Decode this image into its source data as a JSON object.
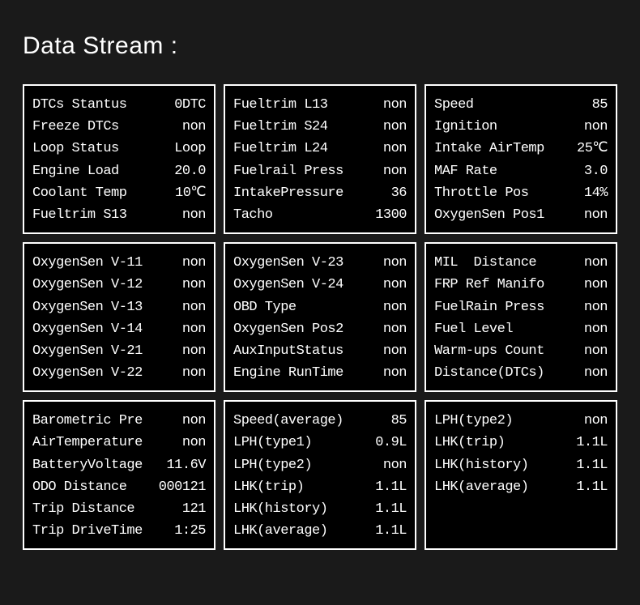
{
  "title": "Data Stream :",
  "panels": [
    {
      "rows": [
        {
          "label": "DTCs Stantus",
          "value": "0DTC"
        },
        {
          "label": "Freeze DTCs",
          "value": "non"
        },
        {
          "label": "Loop Status",
          "value": "Loop"
        },
        {
          "label": "Engine Load",
          "value": "20.0"
        },
        {
          "label": "Coolant Temp",
          "value": "10℃"
        },
        {
          "label": "Fueltrim S13",
          "value": "non"
        }
      ]
    },
    {
      "rows": [
        {
          "label": "Fueltrim L13",
          "value": "non"
        },
        {
          "label": "Fueltrim S24",
          "value": "non"
        },
        {
          "label": "Fueltrim L24",
          "value": "non"
        },
        {
          "label": "Fuelrail Press",
          "value": "non"
        },
        {
          "label": "IntakePressure",
          "value": "36"
        },
        {
          "label": "Tacho",
          "value": "1300"
        }
      ]
    },
    {
      "rows": [
        {
          "label": "Speed",
          "value": "85"
        },
        {
          "label": "Ignition",
          "value": "non"
        },
        {
          "label": "Intake AirTemp",
          "value": "25℃"
        },
        {
          "label": "MAF Rate",
          "value": "3.0"
        },
        {
          "label": "Throttle Pos",
          "value": "14%"
        },
        {
          "label": "OxygenSen Pos1",
          "value": "non"
        }
      ]
    },
    {
      "rows": [
        {
          "label": "OxygenSen V-11",
          "value": "non"
        },
        {
          "label": "OxygenSen V-12",
          "value": "non"
        },
        {
          "label": "OxygenSen V-13",
          "value": "non"
        },
        {
          "label": "OxygenSen V-14",
          "value": "non"
        },
        {
          "label": "OxygenSen V-21",
          "value": "non"
        },
        {
          "label": "OxygenSen V-22",
          "value": "non"
        }
      ]
    },
    {
      "rows": [
        {
          "label": "OxygenSen V-23",
          "value": "non"
        },
        {
          "label": "OxygenSen V-24",
          "value": "non"
        },
        {
          "label": "OBD Type",
          "value": "non"
        },
        {
          "label": "OxygenSen Pos2",
          "value": "non"
        },
        {
          "label": "AuxInputStatus",
          "value": "non"
        },
        {
          "label": "Engine RunTime",
          "value": "non"
        }
      ]
    },
    {
      "rows": [
        {
          "label": "MIL  Distance",
          "value": "non"
        },
        {
          "label": "FRP Ref Manifo",
          "value": "non"
        },
        {
          "label": "FuelRain Press",
          "value": "non"
        },
        {
          "label": "Fuel Level",
          "value": "non"
        },
        {
          "label": "Warm-ups Count",
          "value": "non"
        },
        {
          "label": "Distance(DTCs)",
          "value": "non"
        }
      ]
    },
    {
      "rows": [
        {
          "label": "Barometric Pre",
          "value": "non"
        },
        {
          "label": "AirTemperature",
          "value": "non"
        },
        {
          "label": "BatteryVoltage",
          "value": "11.6V"
        },
        {
          "label": "ODO Distance",
          "value": "000121"
        },
        {
          "label": "Trip Distance",
          "value": "121"
        },
        {
          "label": "Trip DriveTime",
          "value": "1:25"
        }
      ]
    },
    {
      "rows": [
        {
          "label": "Speed(average)",
          "value": "85"
        },
        {
          "label": "LPH(type1)",
          "value": "0.9L"
        },
        {
          "label": "LPH(type2)",
          "value": "non"
        },
        {
          "label": "LHK(trip)",
          "value": "1.1L"
        },
        {
          "label": "LHK(history)",
          "value": "1.1L"
        },
        {
          "label": "LHK(average)",
          "value": "1.1L"
        }
      ]
    },
    {
      "rows": [
        {
          "label": "LPH(type2)",
          "value": "non"
        },
        {
          "label": "LHK(trip)",
          "value": "1.1L"
        },
        {
          "label": "LHK(history)",
          "value": "1.1L"
        },
        {
          "label": "LHK(average)",
          "value": "1.1L"
        }
      ]
    }
  ]
}
